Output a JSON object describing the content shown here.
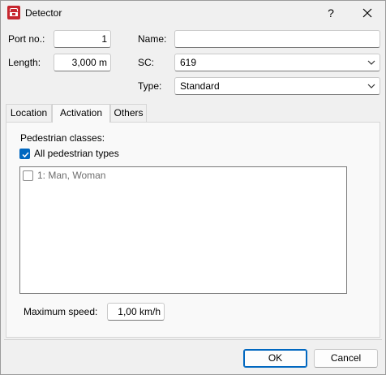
{
  "window": {
    "title": "Detector",
    "help_label": "?"
  },
  "header": {
    "port_no": {
      "label": "Port no.:",
      "value": "1"
    },
    "length": {
      "label": "Length:",
      "value": "3,000 m"
    },
    "name": {
      "label": "Name:",
      "value": ""
    },
    "sc": {
      "label": "SC:",
      "value": "619"
    },
    "type": {
      "label": "Type:",
      "value": "Standard"
    }
  },
  "tabs": [
    {
      "label": "Location",
      "active": false
    },
    {
      "label": "Activation",
      "active": true
    },
    {
      "label": "Others",
      "active": false
    }
  ],
  "activation": {
    "pedestrian_classes_label": "Pedestrian classes:",
    "all_types": {
      "label": "All pedestrian types",
      "checked": true
    },
    "classes": [
      {
        "label": "1: Man, Woman",
        "checked": false,
        "enabled": false
      }
    ],
    "max_speed": {
      "label": "Maximum speed:",
      "value": "1,00 km/h"
    }
  },
  "footer": {
    "ok_label": "OK",
    "cancel_label": "Cancel"
  },
  "colors": {
    "accent": "#0067c0",
    "app_icon": "#c6272f",
    "disabled_text": "#6d6d6d"
  }
}
